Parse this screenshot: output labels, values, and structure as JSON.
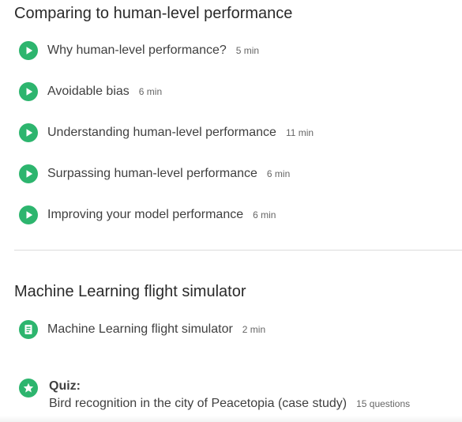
{
  "sections": [
    {
      "title": "Comparing to human-level performance",
      "items": [
        {
          "icon": "play-icon",
          "title": "Why human-level performance?",
          "duration": "5 min"
        },
        {
          "icon": "play-icon",
          "title": "Avoidable bias",
          "duration": "6 min"
        },
        {
          "icon": "play-icon",
          "title": "Understanding human-level performance",
          "duration": "11 min"
        },
        {
          "icon": "play-icon",
          "title": "Surpassing human-level performance",
          "duration": "6 min"
        },
        {
          "icon": "play-icon",
          "title": "Improving your model performance",
          "duration": "6 min"
        }
      ]
    },
    {
      "title": "Machine Learning flight simulator",
      "items": [
        {
          "icon": "reading-icon",
          "title": "Machine Learning flight simulator",
          "duration": "2 min"
        }
      ],
      "quiz": {
        "icon": "star-icon",
        "label": "Quiz:",
        "title": "Bird recognition in the city of Peacetopia (case study)",
        "meta": "15 questions"
      }
    }
  ],
  "colors": {
    "accent": "#2db56e",
    "text": "#3f3f3f",
    "meta": "#666666",
    "divider": "#dcdcdc"
  }
}
